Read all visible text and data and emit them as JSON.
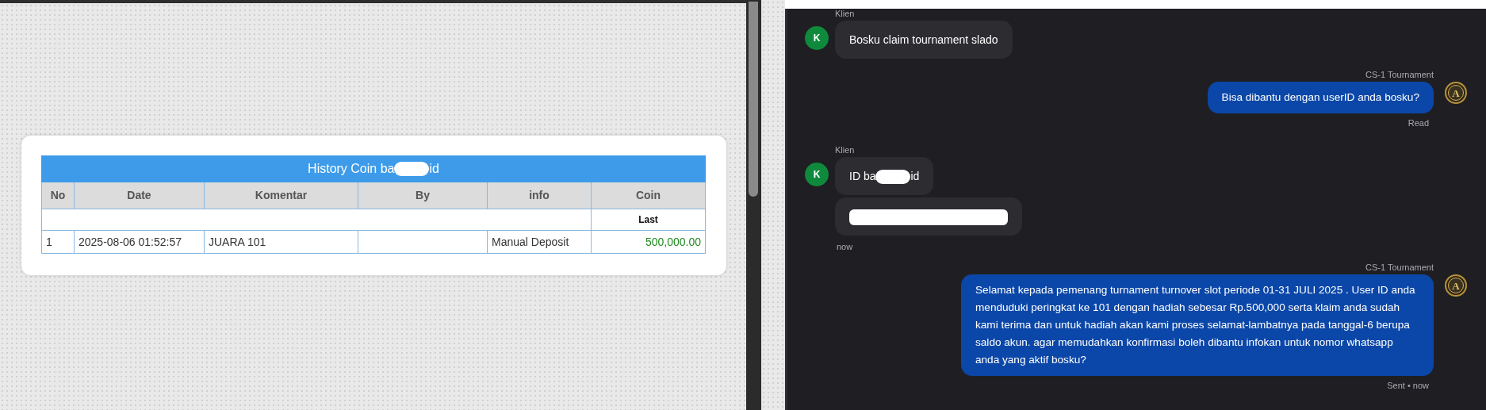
{
  "history": {
    "title_parts": [
      "History Coin ba",
      "id"
    ],
    "columns": [
      "No",
      "Date",
      "Komentar",
      "By",
      "info",
      "Coin"
    ],
    "subheader": "Last",
    "rows": [
      {
        "no": "1",
        "date": "2025-08-06 01:52:57",
        "komentar": "JUARA 101",
        "info": "Manual Deposit",
        "coin": "500,000.00"
      }
    ]
  },
  "chat": {
    "messages": [
      {
        "kind": "incoming",
        "sender": "Klien",
        "avatar": "K",
        "bubbles": [
          {
            "segments": [
              {
                "kind": "text",
                "text": "Bosku claim tournament slado"
              }
            ]
          }
        ]
      },
      {
        "kind": "outgoing",
        "sender": "CS-1 Tournament",
        "avatar": "A",
        "bubbles": [
          {
            "segments": [
              {
                "kind": "text",
                "text": "Bisa dibantu dengan userID anda bosku?"
              }
            ]
          }
        ],
        "status": "Read"
      },
      {
        "kind": "incoming",
        "sender": "Klien",
        "avatar": "K",
        "bubbles": [
          {
            "segments": [
              {
                "kind": "text",
                "text": "ID ba"
              },
              {
                "kind": "redacted"
              },
              {
                "kind": "text",
                "text": "id"
              }
            ]
          },
          {
            "segments": [
              {
                "kind": "redacted_line"
              }
            ]
          }
        ],
        "status": "now"
      },
      {
        "kind": "outgoing",
        "sender": "CS-1 Tournament",
        "avatar": "A",
        "bubbles": [
          {
            "segments": [
              {
                "kind": "text",
                "text": "Selamat kepada pemenang turnament turnover slot periode 01-31 JULI 2025 . User ID anda menduduki peringkat ke 101 dengan hadiah sebesar Rp.500,000 serta klaim anda sudah kami terima dan untuk hadiah akan kami proses selamat-lambatnya pada tanggal-6 berupa saldo akun. agar memudahkan konfirmasi boleh dibantu infokan untuk nomor whatsapp anda yang aktif bosku?"
              }
            ]
          }
        ],
        "status": "Sent • now"
      }
    ]
  }
}
